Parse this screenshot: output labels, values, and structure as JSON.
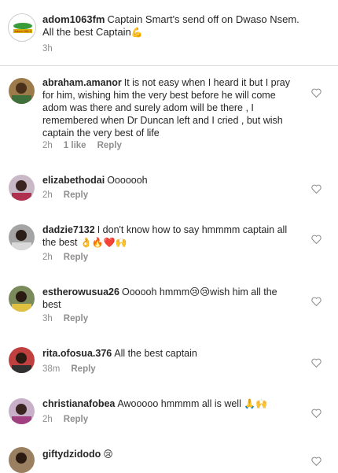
{
  "caption": {
    "username": "adom1063fm",
    "text": "Captain Smart's send off on Dwaso Nsem. All the best Captain",
    "emoji": "💪",
    "time": "3h",
    "logo_text": "Adom 106.3"
  },
  "comments": [
    {
      "username": "abraham.amanor",
      "text": "It is not easy when I heard it but I pray for him, wishing him the very best before he will come adom was there and surely adom will be there , I remembered when Dr Duncan left and I cried , but wish captain the very best of life",
      "emoji": "",
      "time": "2h",
      "likes": "1 like",
      "reply": "Reply"
    },
    {
      "username": "elizabethodai",
      "text": "Ooooooh",
      "emoji": "",
      "time": "2h",
      "likes": "",
      "reply": "Reply"
    },
    {
      "username": "dadzie7132",
      "text": "I don't know how to say hmmmm  captain all the best",
      "emoji": "👌🔥❤️🙌",
      "time": "2h",
      "likes": "",
      "reply": "Reply"
    },
    {
      "username": "estherowusua26",
      "text": "Oooooh hmmm😢😢wish him all the best",
      "emoji": "",
      "time": "3h",
      "likes": "",
      "reply": "Reply"
    },
    {
      "username": "rita.ofosua.376",
      "text": "All the best  captain",
      "emoji": "",
      "time": "38m",
      "likes": "",
      "reply": "Reply"
    },
    {
      "username": "christianafobea",
      "text": "Awooooo hmmmm all is well",
      "emoji": "🙏🙌",
      "time": "2h",
      "likes": "",
      "reply": "Reply"
    },
    {
      "username": "giftydzidodo",
      "text": "",
      "emoji": "😢",
      "time": "",
      "likes": "",
      "reply": ""
    }
  ],
  "icons": {
    "like": "heart-outline-icon"
  },
  "colors": {
    "text": "#262626",
    "meta": "#8e8e8e",
    "divider": "#dbdbdb",
    "brand_green": "#2e8b3a"
  }
}
